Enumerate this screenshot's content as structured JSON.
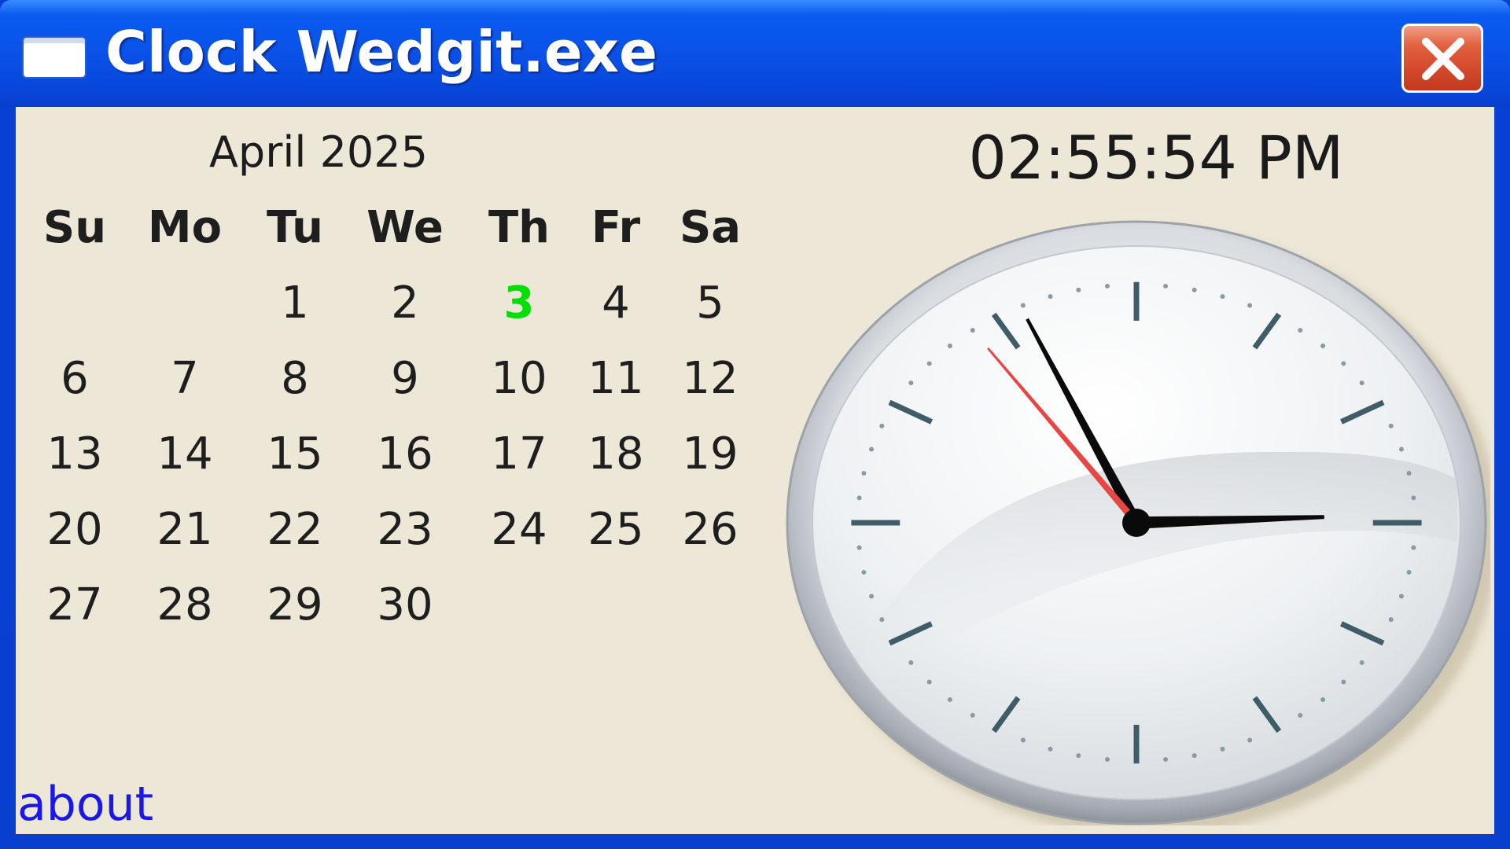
{
  "window": {
    "title": "Clock Wedgit.exe",
    "close_icon": "close-icon",
    "app_icon": "window-icon"
  },
  "calendar": {
    "month_label": "April 2025",
    "weekdays": [
      "Su",
      "Mo",
      "Tu",
      "We",
      "Th",
      "Fr",
      "Sa"
    ],
    "weeks": [
      [
        "",
        "",
        "1",
        "2",
        "3",
        "4",
        "5"
      ],
      [
        "6",
        "7",
        "8",
        "9",
        "10",
        "11",
        "12"
      ],
      [
        "13",
        "14",
        "15",
        "16",
        "17",
        "18",
        "19"
      ],
      [
        "20",
        "21",
        "22",
        "23",
        "24",
        "25",
        "26"
      ],
      [
        "27",
        "28",
        "29",
        "30",
        "",
        "",
        ""
      ]
    ],
    "today": "3",
    "today_color": "#00e000"
  },
  "clock": {
    "digital_time": "02:55:54 PM",
    "hour": 2,
    "minute": 55,
    "second": 54,
    "second_hand_color": "#e84545"
  },
  "footer": {
    "about_label": "about",
    "link_color": "#1a18e8"
  }
}
